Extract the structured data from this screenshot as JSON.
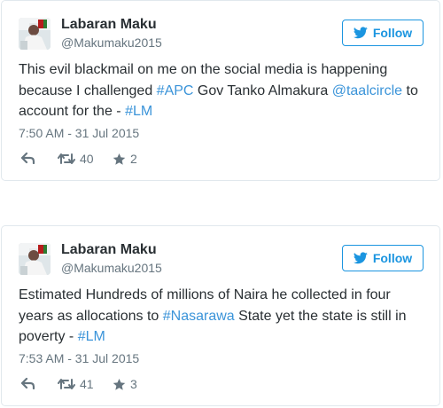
{
  "tweets": [
    {
      "author": "Labaran Maku",
      "handle": "@Makumaku2015",
      "follow_label": "Follow",
      "text_parts": {
        "p1": "This evil blackmail on me on the social media is happening because I challenged ",
        "tag1": "#APC",
        "p2": " Gov Tanko Almakura ",
        "tag2": "@taalcircle",
        "p3": " to account for the - ",
        "tag3": "#LM"
      },
      "timestamp": "7:50 AM - 31 Jul 2015",
      "retweets": "40",
      "favorites": "2"
    },
    {
      "author": "Labaran Maku",
      "handle": "@Makumaku2015",
      "follow_label": "Follow",
      "text_parts": {
        "p1": "Estimated Hundreds of millions of Naira he collected in four years as allocations to ",
        "tag1": "#Nasarawa",
        "p2": " State yet the state is still in poverty - ",
        "tag2": "#LM"
      },
      "timestamp": "7:53 AM - 31 Jul 2015",
      "retweets": "41",
      "favorites": "3"
    }
  ],
  "icons": {
    "follow": "twitter-bird-icon",
    "reply": "reply-arrow-icon",
    "retweet": "retweet-icon",
    "favorite": "star-icon"
  },
  "colors": {
    "accent": "#1b95e0",
    "hashtag": "#3b94d9",
    "muted": "#66757f",
    "text": "#292f33",
    "border": "#e1e8ed"
  }
}
